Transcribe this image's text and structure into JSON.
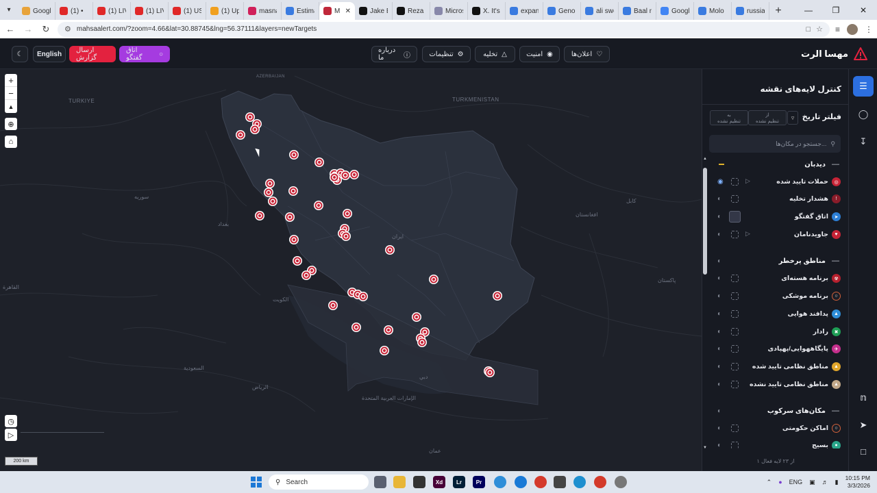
{
  "browser": {
    "tabs": [
      {
        "label": "Googl",
        "color": "#e8a33a"
      },
      {
        "label": "(1) •",
        "color": "#e02828"
      },
      {
        "label": "(1) LIV",
        "color": "#e02828"
      },
      {
        "label": "(1) LIV",
        "color": "#e02828"
      },
      {
        "label": "(1) US",
        "color": "#e02828"
      },
      {
        "label": "(1) Up",
        "color": "#f0a020"
      },
      {
        "label": "masna",
        "color": "#d0205a"
      },
      {
        "label": "Estima",
        "color": "#3a7be0"
      },
      {
        "label": "M",
        "color": "#c0283a",
        "active": true
      },
      {
        "label": "Jake E",
        "color": "#111111"
      },
      {
        "label": "Reza P",
        "color": "#111111"
      },
      {
        "label": "Micros",
        "color": "#8888aa"
      },
      {
        "label": "X. It's",
        "color": "#111111"
      },
      {
        "label": "expan",
        "color": "#3a7be0"
      },
      {
        "label": "Geno",
        "color": "#3a7be0"
      },
      {
        "label": "ali swe",
        "color": "#3a7be0"
      },
      {
        "label": "Baal n",
        "color": "#3a7be0"
      },
      {
        "label": "Googl",
        "color": "#4285f4"
      },
      {
        "label": "Molo",
        "color": "#3a7be0"
      },
      {
        "label": "russia",
        "color": "#3a7be0"
      }
    ],
    "url": "mahsaalert.com/?zoom=4.66&lat=30.88745&lng=56.37111&layers=newTargets"
  },
  "header": {
    "brand": "مهسا الرت",
    "nav": {
      "alerts": "اعلان‌ها",
      "security": "امنیت",
      "evacuation": "تخلیه",
      "settings": "تنظیمات",
      "about": "درباره ما"
    },
    "chat_button": "اتاق گفتگو",
    "report_button": "ارسال گزارش",
    "lang_button": "English"
  },
  "map": {
    "labels": {
      "turkey": "TURKIYE",
      "turkmenistan": "TURKMENISTAN",
      "azerbaijan": "AZERBAIJAN",
      "iran": "ایران",
      "baghdad": "بغداد",
      "syria": "سوریه",
      "afghanistan": "افغانستان",
      "kabul": "کابل",
      "pakistan": "پاکستان",
      "saudi": "السعودية",
      "riyadh": "الرياض",
      "uae": "الإمارات العربية المتحدة",
      "dubai": "دبي",
      "oman": "عمان",
      "cairo": "القاهرة",
      "kuwait": "الكويت"
    },
    "scale": "200 km"
  },
  "panel": {
    "title": "کنترل لایه‌های نقشه",
    "date_filter": "فیلتر تاریخ",
    "from_label": "از",
    "to_label": "به",
    "unset": "تنظیم نشده",
    "search_placeholder": "جستجو در مکان‌ها...",
    "sections": [
      {
        "title": "دیدبان"
      },
      {
        "title": "مناطق پرخطر"
      },
      {
        "title": "مکان‌های سرکوب"
      }
    ],
    "layers": [
      {
        "label": "حملات تایید شده",
        "color": "#c62336",
        "glyph": "◎",
        "visible": true,
        "play": true
      },
      {
        "label": "هشدار تخلیه",
        "color": "#8a1c2a",
        "glyph": "!",
        "visible": false
      },
      {
        "label": "اتاق گفتگو",
        "color": "#2d7fd6",
        "glyph": "➤",
        "visible": false
      },
      {
        "label": "جاویدنامان",
        "color": "#c62336",
        "glyph": "♥",
        "visible": false,
        "play": true
      },
      {
        "label": "برنامه هسته‌ای",
        "color": "#b5202e",
        "glyph": "☢",
        "visible": false
      },
      {
        "label": "برنامه موشکی",
        "color": "#1b1e26",
        "glyph": "○",
        "visible": false
      },
      {
        "label": "پدافند هوایی",
        "color": "#2f8ed8",
        "glyph": "▲",
        "visible": false
      },
      {
        "label": "رادار",
        "color": "#1e9e55",
        "glyph": "✖",
        "visible": false
      },
      {
        "label": "پایگاههوایی/پهپادی",
        "color": "#c42f8c",
        "glyph": "✈",
        "visible": false
      },
      {
        "label": "مناطق نظامی تایید شده",
        "color": "#e0a52a",
        "glyph": "▲",
        "visible": false
      },
      {
        "label": "مناطق نظامی تایید نشده",
        "color": "#c2a88a",
        "glyph": "▲",
        "visible": false
      },
      {
        "label": "اماکن حکومتی",
        "color": "#1b1e26",
        "glyph": "○",
        "visible": false
      },
      {
        "label": "بسیج",
        "color": "#2aa58a",
        "glyph": "●",
        "visible": false
      }
    ],
    "footer": "۱ از ۲۳ لایه فعال"
  },
  "taskbar": {
    "search": "Search",
    "lang": "ENG",
    "time": "10:15 PM",
    "date": "3/3/2026"
  }
}
